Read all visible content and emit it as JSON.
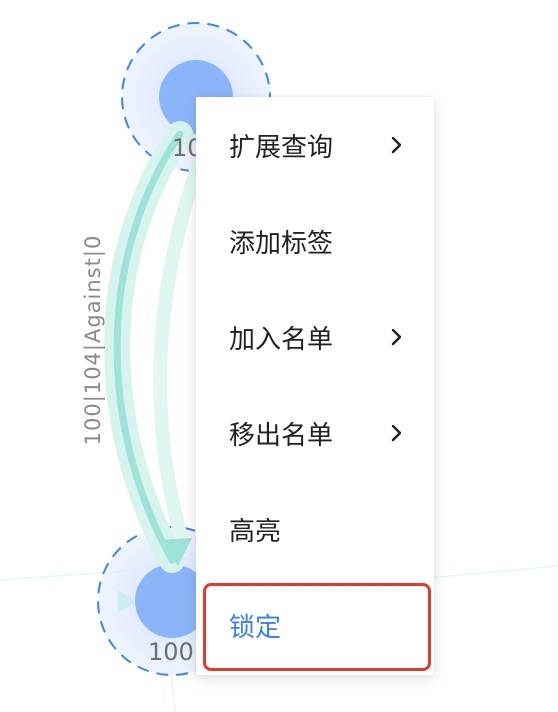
{
  "graph": {
    "edge_label": "100|104|Against|0",
    "node_top_label": "10",
    "node_bottom_label": "100"
  },
  "context_menu": {
    "items": [
      {
        "label": "扩展查询",
        "has_submenu": true
      },
      {
        "label": "添加标签",
        "has_submenu": false
      },
      {
        "label": "加入名单",
        "has_submenu": true
      },
      {
        "label": "移出名单",
        "has_submenu": true
      },
      {
        "label": "高亮",
        "has_submenu": false
      },
      {
        "label": "锁定",
        "has_submenu": false,
        "highlighted": true
      }
    ]
  },
  "colors": {
    "accent": "#3a7ff0",
    "node_fill": "#8bb5f8",
    "edge": "#8ee0d4",
    "highlight_border": "#e03a2f"
  }
}
